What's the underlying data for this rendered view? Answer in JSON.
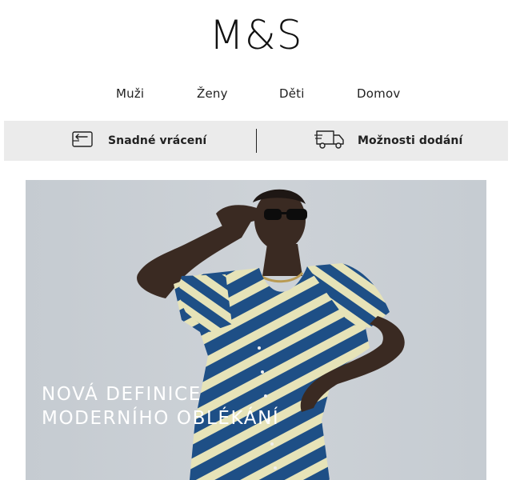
{
  "brand": {
    "logo_text": "M&S"
  },
  "nav": {
    "items": [
      {
        "label": "Muži"
      },
      {
        "label": "Ženy"
      },
      {
        "label": "Děti"
      },
      {
        "label": "Domov"
      }
    ]
  },
  "services": {
    "returns": {
      "label": "Snadné vrácení",
      "icon": "return-tag-icon"
    },
    "delivery": {
      "label": "Možnosti dodání",
      "icon": "delivery-truck-icon"
    }
  },
  "hero": {
    "headline_line1": "NOVÁ DEFINICE",
    "headline_line2": "MODERNÍHO OBLÉKÁNÍ",
    "image": "woman-in-striped-dress-with-sunglasses"
  },
  "colors": {
    "service_bar_bg": "#ebebeb",
    "dress_blue": "#1e4f86",
    "dress_cream": "#e6e3b8"
  }
}
